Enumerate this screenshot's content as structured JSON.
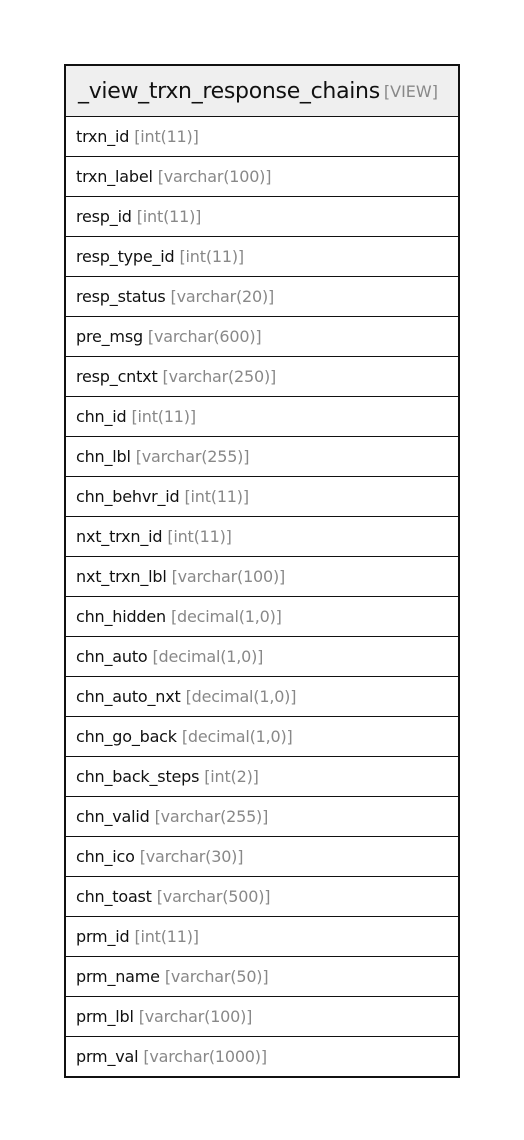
{
  "entity": {
    "name": "_view_trxn_response_chains",
    "kind": "[VIEW]",
    "columns": [
      {
        "name": "trxn_id",
        "type": "[int(11)]"
      },
      {
        "name": "trxn_label",
        "type": "[varchar(100)]"
      },
      {
        "name": "resp_id",
        "type": "[int(11)]"
      },
      {
        "name": "resp_type_id",
        "type": "[int(11)]"
      },
      {
        "name": "resp_status",
        "type": "[varchar(20)]"
      },
      {
        "name": "pre_msg",
        "type": "[varchar(600)]"
      },
      {
        "name": "resp_cntxt",
        "type": "[varchar(250)]"
      },
      {
        "name": "chn_id",
        "type": "[int(11)]"
      },
      {
        "name": "chn_lbl",
        "type": "[varchar(255)]"
      },
      {
        "name": "chn_behvr_id",
        "type": "[int(11)]"
      },
      {
        "name": "nxt_trxn_id",
        "type": "[int(11)]"
      },
      {
        "name": "nxt_trxn_lbl",
        "type": "[varchar(100)]"
      },
      {
        "name": "chn_hidden",
        "type": "[decimal(1,0)]"
      },
      {
        "name": "chn_auto",
        "type": "[decimal(1,0)]"
      },
      {
        "name": "chn_auto_nxt",
        "type": "[decimal(1,0)]"
      },
      {
        "name": "chn_go_back",
        "type": "[decimal(1,0)]"
      },
      {
        "name": "chn_back_steps",
        "type": "[int(2)]"
      },
      {
        "name": "chn_valid",
        "type": "[varchar(255)]"
      },
      {
        "name": "chn_ico",
        "type": "[varchar(30)]"
      },
      {
        "name": "chn_toast",
        "type": "[varchar(500)]"
      },
      {
        "name": "prm_id",
        "type": "[int(11)]"
      },
      {
        "name": "prm_name",
        "type": "[varchar(50)]"
      },
      {
        "name": "prm_lbl",
        "type": "[varchar(100)]"
      },
      {
        "name": "prm_val",
        "type": "[varchar(1000)]"
      }
    ]
  }
}
